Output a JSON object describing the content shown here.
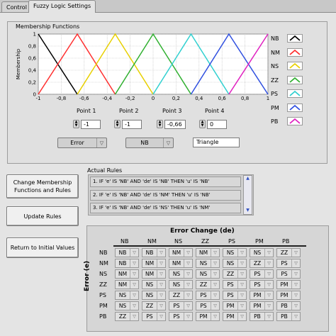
{
  "tabs": [
    {
      "label": "Control"
    },
    {
      "label": "Fuzzy Logic Settings"
    }
  ],
  "mf": {
    "title": "Membership Functions",
    "ylabel": "Membership",
    "yticks": [
      "1",
      "0,8",
      "0,6",
      "0,4",
      "0,2",
      "0"
    ],
    "xticks": [
      "-1",
      "-0,8",
      "-0,6",
      "-0,4",
      "-0,2",
      "0",
      "0,2",
      "0,4",
      "0,6",
      "0,8",
      "1"
    ],
    "legend": [
      {
        "name": "NB",
        "color": "#000000"
      },
      {
        "name": "NM",
        "color": "#ff3030"
      },
      {
        "name": "NS",
        "color": "#e8d000"
      },
      {
        "name": "ZZ",
        "color": "#30b030"
      },
      {
        "name": "PS",
        "color": "#30d0d0"
      },
      {
        "name": "PM",
        "color": "#3050e0"
      },
      {
        "name": "PB",
        "color": "#e020c0"
      }
    ]
  },
  "chart_data": {
    "type": "line",
    "title": "Membership Functions",
    "xlabel": "",
    "ylabel": "Membership",
    "xlim": [
      -1,
      1
    ],
    "ylim": [
      0,
      1
    ],
    "grid": true,
    "legend_position": "right",
    "series": [
      {
        "name": "NB",
        "color": "#000000",
        "x": [
          -1,
          -0.66
        ],
        "y": [
          1,
          0
        ]
      },
      {
        "name": "NM",
        "color": "#ff3030",
        "x": [
          -1,
          -0.66,
          -0.33
        ],
        "y": [
          0,
          1,
          0
        ]
      },
      {
        "name": "NS",
        "color": "#e8d000",
        "x": [
          -0.66,
          -0.33,
          0
        ],
        "y": [
          0,
          1,
          0
        ]
      },
      {
        "name": "ZZ",
        "color": "#30b030",
        "x": [
          -0.33,
          0,
          0.33
        ],
        "y": [
          0,
          1,
          0
        ]
      },
      {
        "name": "PS",
        "color": "#30d0d0",
        "x": [
          0,
          0.33,
          0.66
        ],
        "y": [
          0,
          1,
          0
        ]
      },
      {
        "name": "PM",
        "color": "#3050e0",
        "x": [
          0.33,
          0.66,
          1
        ],
        "y": [
          0,
          1,
          0
        ]
      },
      {
        "name": "PB",
        "color": "#e020c0",
        "x": [
          0.66,
          1
        ],
        "y": [
          0,
          1
        ]
      }
    ]
  },
  "points": {
    "labels": [
      "Point 1",
      "Point 2",
      "Point 3",
      "Point 4"
    ],
    "values": [
      "-1",
      "-1",
      "-0,66",
      "0"
    ]
  },
  "selectors": {
    "variable": "Error",
    "set": "NB",
    "shape": "Triangle"
  },
  "buttons": {
    "change": "Change Membership Functions and Rules",
    "update": "Update Rules",
    "reset": "Return to Initial Values"
  },
  "rules": {
    "title": "Actual Rules",
    "items": [
      "1. IF 'e' IS 'NB' AND 'de' IS 'NB' THEN 'u' IS 'NB'",
      "2. IF 'e' IS 'NB' AND 'de' IS 'NM' THEN 'u' IS 'NB'",
      "3. IF 'e' IS 'NB' AND 'de' IS 'NS' THEN 'u' IS 'NM'"
    ]
  },
  "table": {
    "title": "Error Change (de)",
    "row_axis": "Error (e)",
    "cols": [
      "NB",
      "NM",
      "NS",
      "ZZ",
      "PS",
      "PM",
      "PB"
    ],
    "rows": [
      "NB",
      "NM",
      "NS",
      "ZZ",
      "PS",
      "PM",
      "PB"
    ],
    "cells": [
      [
        "NB",
        "NB",
        "NM",
        "NM",
        "NS",
        "NS",
        "ZZ"
      ],
      [
        "NB",
        "NM",
        "NM",
        "NS",
        "NS",
        "ZZ",
        "PS"
      ],
      [
        "NM",
        "NM",
        "NS",
        "NS",
        "ZZ",
        "PS",
        "PS"
      ],
      [
        "NM",
        "NS",
        "NS",
        "ZZ",
        "PS",
        "PS",
        "PM"
      ],
      [
        "NS",
        "NS",
        "ZZ",
        "PS",
        "PS",
        "PM",
        "PM"
      ],
      [
        "NS",
        "ZZ",
        "PS",
        "PS",
        "PM",
        "PM",
        "PB"
      ],
      [
        "ZZ",
        "PS",
        "PS",
        "PM",
        "PM",
        "PB",
        "PB"
      ]
    ]
  }
}
